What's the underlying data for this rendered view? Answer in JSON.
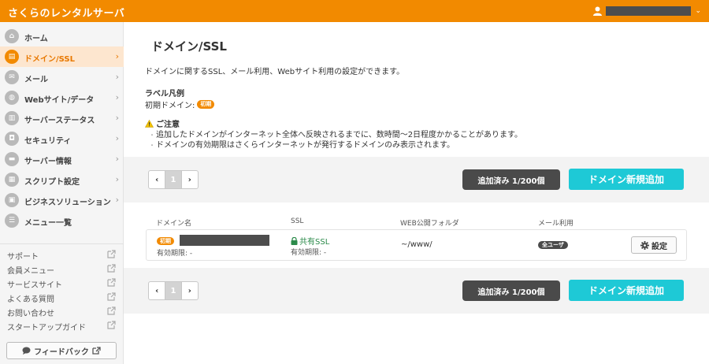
{
  "header": {
    "brand": "さくらのレンタルサーバ"
  },
  "sidebar": {
    "nav": [
      {
        "label": "ホーム",
        "icon": "home-icon",
        "active": false
      },
      {
        "label": "ドメイン/SSL",
        "icon": "domain-icon",
        "active": true
      },
      {
        "label": "メール",
        "icon": "mail-icon",
        "active": false
      },
      {
        "label": "Webサイト/データ",
        "icon": "globe-icon",
        "active": false
      },
      {
        "label": "サーバーステータス",
        "icon": "chart-icon",
        "active": false
      },
      {
        "label": "セキュリティ",
        "icon": "lock-icon",
        "active": false
      },
      {
        "label": "サーバー情報",
        "icon": "server-icon",
        "active": false
      },
      {
        "label": "スクリプト設定",
        "icon": "script-icon",
        "active": false
      },
      {
        "label": "ビジネスソリューション",
        "icon": "business-icon",
        "active": false
      },
      {
        "label": "メニュー一覧",
        "icon": "menu-list-icon",
        "active": false
      }
    ],
    "links": [
      {
        "label": "サポート"
      },
      {
        "label": "会員メニュー"
      },
      {
        "label": "サービスサイト"
      },
      {
        "label": "よくある質問"
      },
      {
        "label": "お問い合わせ"
      },
      {
        "label": "スタートアップガイド"
      }
    ],
    "feedback_label": "フィードバック"
  },
  "main": {
    "title": "ドメイン/SSL",
    "description": "ドメインに関するSSL、メール利用、Webサイト利用の設定ができます。",
    "legend_title": "ラベル凡例",
    "legend_label": "初期ドメイン:",
    "legend_badge": "初期",
    "notice_title": "ご注意",
    "notes": [
      "追加したドメインがインターネット全体へ反映されるまでに、数時間〜2日程度かかることがあります。",
      "ドメインの有効期限はさくらインターネットが発行するドメインのみ表示されます。"
    ],
    "pager": {
      "prev": "‹",
      "page": "1",
      "next": "›"
    },
    "count_label": "追加済み 1/200個",
    "add_label": "ドメイン新規追加",
    "table": {
      "headers": [
        "ドメイン名",
        "SSL",
        "WEB公開フォルダ",
        "メール利用"
      ],
      "row": {
        "badge": "初期",
        "expiry": "有効期限: -",
        "ssl_label": "共有SSL",
        "ssl_expiry": "有効期限: -",
        "folder": "~/www/",
        "mail_badge": "全ユーザ",
        "settings_label": "設定"
      }
    }
  },
  "colors": {
    "accent": "#f28a00",
    "cyan": "#1ec9d6",
    "dark": "#4a4a4a",
    "ssl_green": "#2b8a4a"
  }
}
